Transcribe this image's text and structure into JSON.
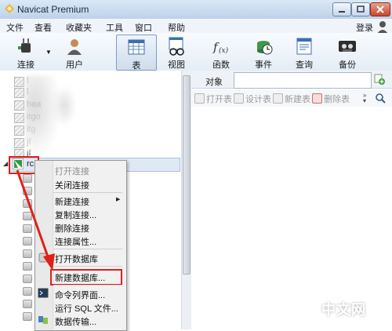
{
  "window": {
    "title": "Navicat Premium"
  },
  "menubar": {
    "items": [
      "文件",
      "查看",
      "收藏夹",
      "工具",
      "窗口",
      "帮助"
    ],
    "login": "登录"
  },
  "toolbar": {
    "buttons": [
      {
        "label": "连接",
        "icon": "plug-icon"
      },
      {
        "label": "用户",
        "icon": "user-icon"
      },
      {
        "label": "表",
        "icon": "table-icon",
        "active": true
      },
      {
        "label": "视图",
        "icon": "view-icon"
      },
      {
        "label": "函数",
        "icon": "function-icon"
      },
      {
        "label": "事件",
        "icon": "event-clock-icon"
      },
      {
        "label": "查询",
        "icon": "query-icon"
      },
      {
        "label": "备份",
        "icon": "backup-tape-icon"
      }
    ]
  },
  "tree": {
    "rows": [
      "l",
      "l",
      "hea",
      "itgo",
      "itg",
      "jf",
      "jf"
    ],
    "selected_label": "rc"
  },
  "object_panel": {
    "tab": "对象",
    "search_placeholder": "",
    "buttons": [
      "打开表",
      "设计表",
      "新建表",
      "删除表"
    ]
  },
  "context_menu": {
    "items": [
      {
        "label": "打开连接",
        "disabled": true
      },
      {
        "label": "关闭连接",
        "disabled": false
      },
      {
        "label": "新建连接",
        "disabled": false,
        "submenu": true
      },
      {
        "label": "复制连接...",
        "disabled": false
      },
      {
        "label": "删除连接",
        "disabled": false
      },
      {
        "label": "连接属性...",
        "disabled": false
      },
      {
        "label": "打开数据库",
        "disabled": false
      },
      {
        "label": "新建数据库...",
        "disabled": false,
        "highlighted": true
      },
      {
        "label": "命令列界面...",
        "disabled": false
      },
      {
        "label": "运行 SQL 文件...",
        "disabled": false
      },
      {
        "label": "数据传输...",
        "disabled": false
      }
    ]
  },
  "colors": {
    "annotation_red": "#e1201a",
    "accent_blue": "#a8c1e0"
  },
  "watermark": {
    "text": "php 中文网"
  }
}
